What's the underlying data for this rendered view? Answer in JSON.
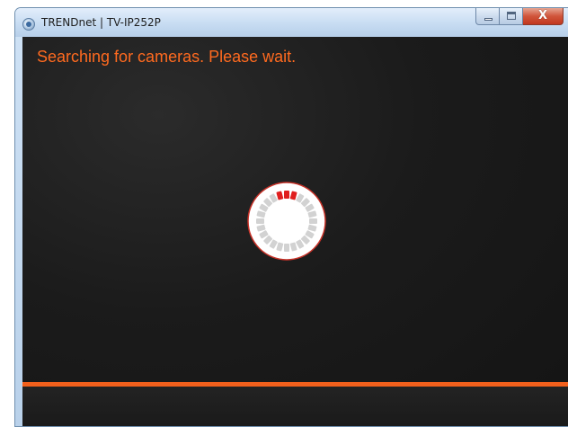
{
  "window": {
    "title": "TRENDnet | TV-IP252P",
    "icon": "trendnet-app-icon",
    "controls": {
      "minimize_icon": "minimize-icon",
      "maximize_icon": "maximize-icon",
      "close_icon": "close-icon",
      "close_glyph": "X"
    }
  },
  "main": {
    "status_text": "Searching for cameras. Please wait.",
    "spinner": {
      "icon": "loading-spinner-icon",
      "segments": 24,
      "active_segments": [
        0,
        1,
        23
      ],
      "colors": {
        "active": "#e01e1e",
        "inactive": "#d2d2d2",
        "ring": "#c83228",
        "background": "#ffffff"
      }
    }
  },
  "colors": {
    "accent": "#ff6a1f",
    "bar": "#f2601c",
    "client_background": "#1b1b1b"
  }
}
